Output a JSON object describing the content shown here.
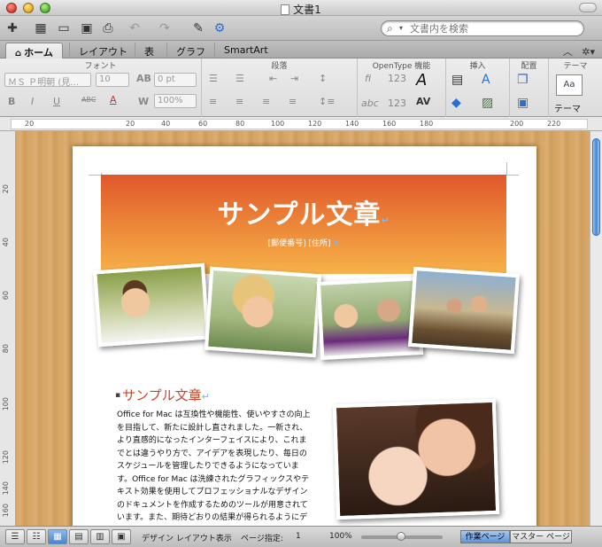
{
  "window": {
    "title": "文書1"
  },
  "search": {
    "placeholder": "文書内を検索"
  },
  "ribbon_tabs": [
    {
      "label": "ホーム",
      "active": true
    },
    {
      "label": "レイアウト"
    },
    {
      "label": "表"
    },
    {
      "label": "グラフ"
    },
    {
      "label": "SmartArt"
    }
  ],
  "ribbon": {
    "font_group": "フォント",
    "paragraph_group": "段落",
    "opentype_group": "OpenType 機能",
    "insert_group": "挿入",
    "arrange_group": "配置",
    "theme_group": "テーマ",
    "font_name": "ＭＳ Ｐ明朝 (見…",
    "font_size": "10",
    "spacing": "0 pt",
    "scale": "100%",
    "theme_label": "テーマ"
  },
  "ruler": {
    "marks": [
      "20",
      "20",
      "40",
      "60",
      "80",
      "100",
      "120",
      "140",
      "160",
      "180",
      "200",
      "220"
    ]
  },
  "vruler": {
    "marks": [
      "20",
      "40",
      "60",
      "80",
      "100",
      "120",
      "140",
      "160"
    ]
  },
  "document": {
    "banner_title": "サンプル文章",
    "banner_sub": "[郵便番号] [住所]",
    "section_title": "サンプル文章",
    "body_lines": [
      "Office for Mac は互換性や機能性、使いやすさの向上",
      "を目指して、新たに設計し直されました。一新され、",
      "より直感的になったインターフェイスにより、これま",
      "でとは違うやり方で、アイデアを表現したり、毎日の",
      "スケジュールを管理したりできるようになっていま",
      "す。Office for Mac は洗練されたグラフィックスやテ",
      "キスト効果を使用してプロフェッショナルなデザイン",
      "のドキュメントを作成するためのツールが用意されて",
      "います。また、期待どおりの結果が得られるようにデ"
    ]
  },
  "status": {
    "view_name": "デザイン レイアウト表示",
    "page_label": "ページ指定:",
    "page_number": "1",
    "zoom": "100%",
    "tab_work": "作業ページ",
    "tab_master": "マスター ページ"
  },
  "colors": {
    "accent_orange": "#e0572b",
    "section_red": "#c9442b",
    "wood": "#d6a565"
  }
}
